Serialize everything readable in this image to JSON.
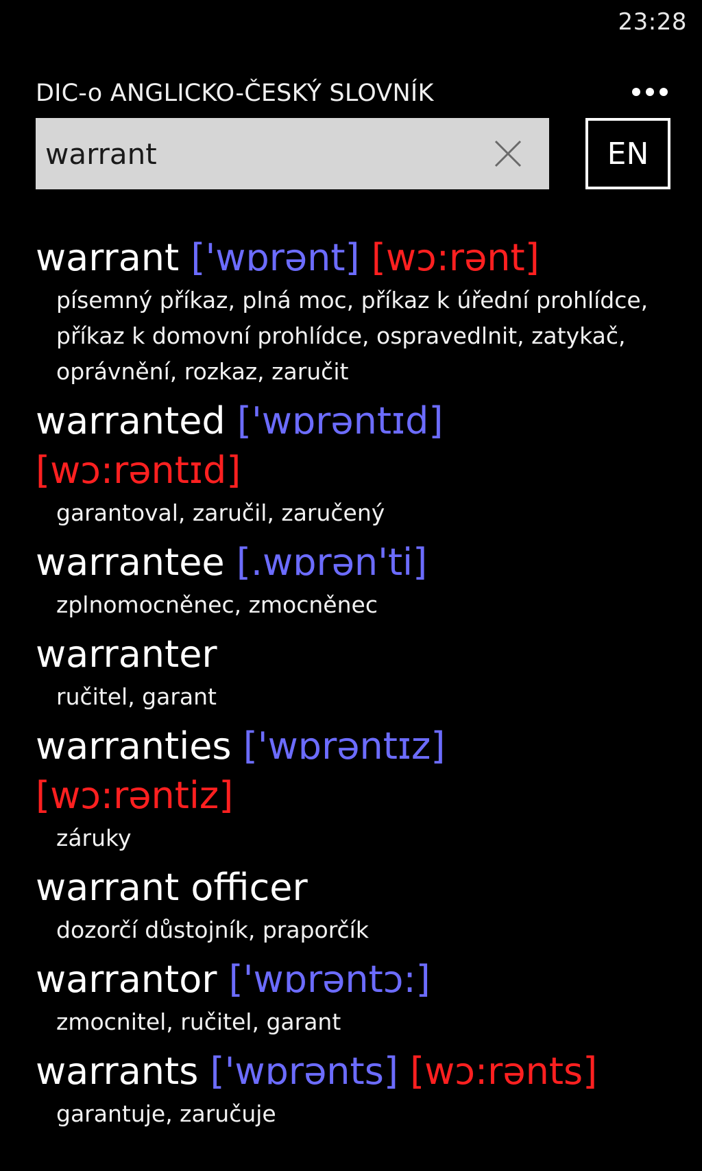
{
  "status": {
    "time": "23:28"
  },
  "header": {
    "title": "DIC-o ANGLICKO-ČESKÝ SLOVNÍK"
  },
  "search": {
    "value": "warrant",
    "lang_button": "EN"
  },
  "colors": {
    "uk_pron": "#6c6cff",
    "us_pron": "#ff2020",
    "search_bg": "#d6d6d6"
  },
  "results": [
    {
      "word": "warrant",
      "pron_uk": "['wɒrənt]",
      "pron_us": "[wɔ:rənt]",
      "translation": "písemný příkaz, plná moc, příkaz k úřední prohlídce, příkaz k domovní prohlídce, ospravedlnit, zatykač, oprávnění, rozkaz, zaručit"
    },
    {
      "word": "warranted",
      "pron_uk": "['wɒrəntɪd]",
      "pron_us": "[wɔ:rəntɪd]",
      "translation": "garantoval, zaručil, zaručený"
    },
    {
      "word": "warrantee",
      "pron_uk": "[.wɒrən'ti]",
      "pron_us": "",
      "translation": "zplnomocněnec, zmocněnec"
    },
    {
      "word": "warranter",
      "pron_uk": "",
      "pron_us": "",
      "translation": "ručitel, garant"
    },
    {
      "word": "warranties",
      "pron_uk": "['wɒrəntɪz]",
      "pron_us": "[wɔ:rəntiz]",
      "translation": "záruky"
    },
    {
      "word": "warrant officer",
      "pron_uk": "",
      "pron_us": "",
      "translation": "dozorčí důstojník, praporčík"
    },
    {
      "word": "warrantor",
      "pron_uk": "['wɒrəntɔ:]",
      "pron_us": "",
      "translation": "zmocnitel, ručitel, garant"
    },
    {
      "word": "warrants",
      "pron_uk": "['wɒrənts]",
      "pron_us": "[wɔ:rənts]",
      "translation": "garantuje, zaručuje"
    }
  ]
}
